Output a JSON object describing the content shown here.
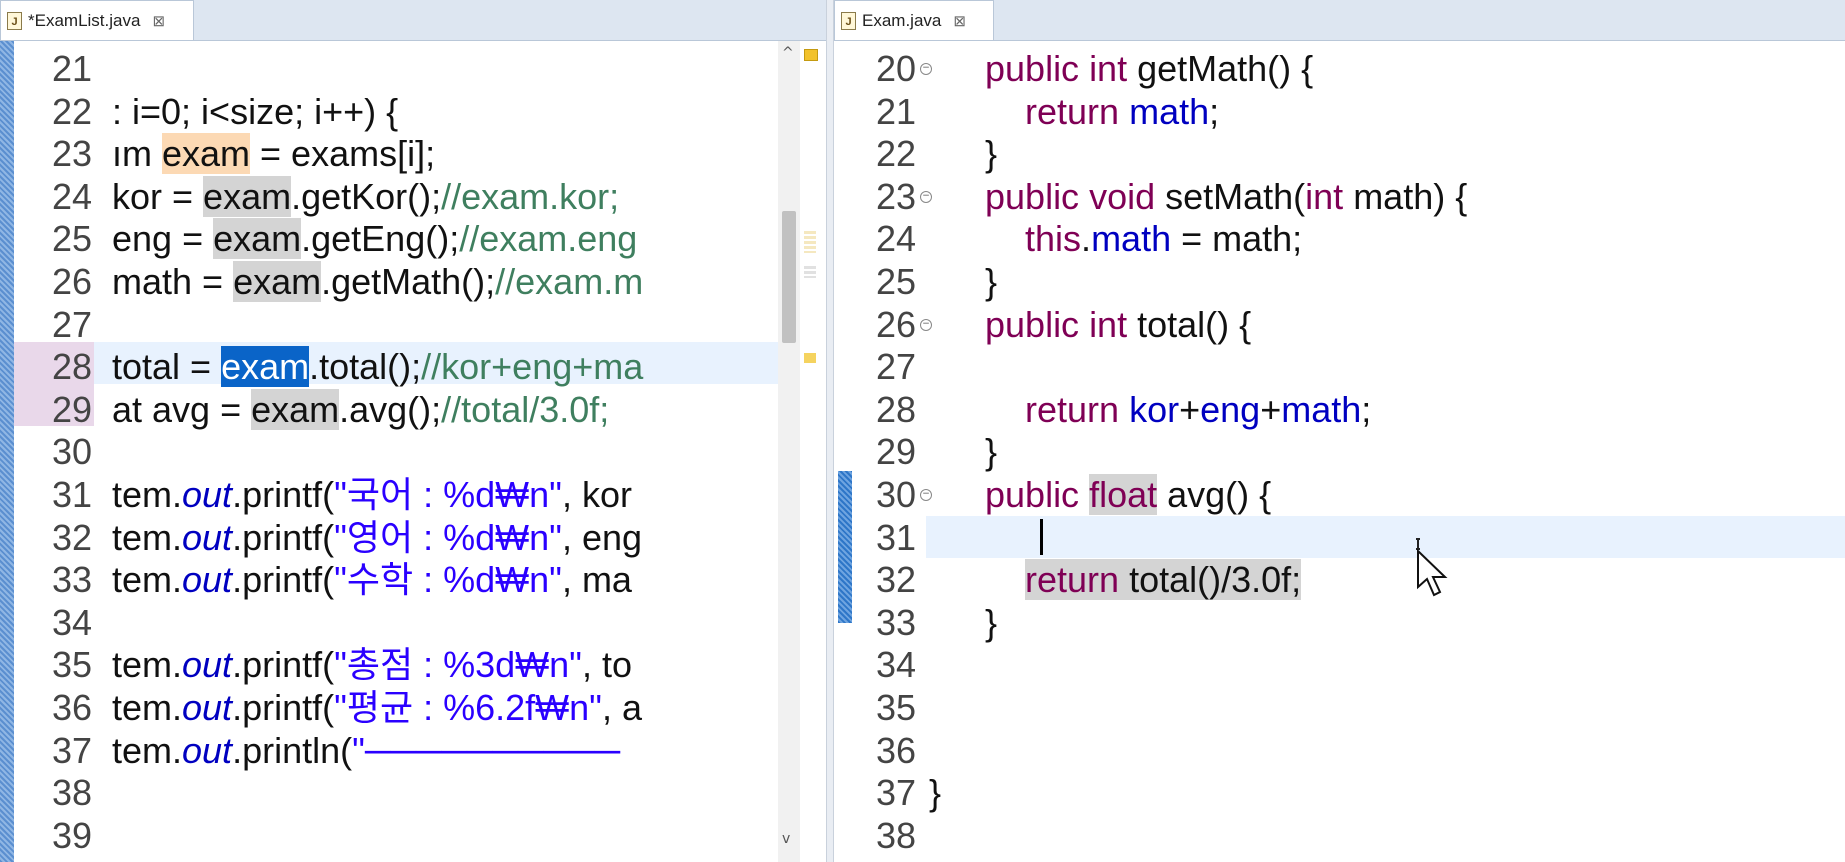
{
  "left_editor": {
    "tab": {
      "label": "*ExamList.java",
      "icon": "java-file-icon",
      "close_icon": "close-icon"
    },
    "lines": [
      {
        "n": "21",
        "html": ""
      },
      {
        "n": "22",
        "html": ": i=0; i&lt;size; i++) {"
      },
      {
        "n": "23",
        "html": "ım <span class=\"hl-or\">exam</span> = exams[i];"
      },
      {
        "n": "24",
        "html": "kor = <span class=\"occ\">exam</span>.getKor();<span class=\"cm\">//exam.kor;</span>"
      },
      {
        "n": "25",
        "html": "eng = <span class=\"occ\">exam</span>.getEng();<span class=\"cm\">//exam.eng</span>"
      },
      {
        "n": "26",
        "html": "math = <span class=\"occ\">exam</span>.getMath();<span class=\"cm\">//exam.m</span>"
      },
      {
        "n": "27",
        "html": ""
      },
      {
        "n": "28",
        "html": "total = <span class=\"sel\">exam</span>.total();<span class=\"cm\">//kor+eng+ma</span>"
      },
      {
        "n": "29",
        "html": "at avg = <span class=\"occ\">exam</span>.avg();<span class=\"cm\">//total/3.0f;</span>"
      },
      {
        "n": "30",
        "html": ""
      },
      {
        "n": "31",
        "html": "tem.<span class=\"it\">out</span>.printf(<span class=\"str\">\"국어 : %d₩n\"</span>, kor"
      },
      {
        "n": "32",
        "html": "tem.<span class=\"it\">out</span>.printf(<span class=\"str\">\"영어 : %d₩n\"</span>, eng"
      },
      {
        "n": "33",
        "html": "tem.<span class=\"it\">out</span>.printf(<span class=\"str\">\"수학 : %d₩n\"</span>, ma"
      },
      {
        "n": "34",
        "html": ""
      },
      {
        "n": "35",
        "html": "tem.<span class=\"it\">out</span>.printf(<span class=\"str\">\"총점 : %3d₩n\"</span>, to"
      },
      {
        "n": "36",
        "html": "tem.<span class=\"it\">out</span>.printf(<span class=\"str\">\"평균 : %6.2f₩n\"</span>, a"
      },
      {
        "n": "37",
        "html": "tem.<span class=\"it\">out</span>.println(<span class=\"str\">\"──────────</span>"
      },
      {
        "n": "38",
        "html": ""
      },
      {
        "n": "39",
        "html": ""
      }
    ]
  },
  "right_editor": {
    "tab": {
      "label": "Exam.java",
      "icon": "java-file-icon",
      "close_icon": "close-icon"
    },
    "lines": [
      {
        "n": "20",
        "fold": true,
        "html": "<span class=\"kw\">public int</span> getMath() {"
      },
      {
        "n": "21",
        "html": "    <span class=\"kw\">return</span> <span class=\"fld\">math</span>;"
      },
      {
        "n": "22",
        "html": "}"
      },
      {
        "n": "23",
        "fold": true,
        "html": "<span class=\"kw\">public void</span> setMath(<span class=\"kw\">int</span> math) {"
      },
      {
        "n": "24",
        "html": "    <span class=\"kw\">this</span>.<span class=\"fld\">math</span> = math;"
      },
      {
        "n": "25",
        "html": "}"
      },
      {
        "n": "26",
        "fold": true,
        "html": "<span class=\"kw\">public int</span> total() {"
      },
      {
        "n": "27",
        "html": ""
      },
      {
        "n": "28",
        "html": "    <span class=\"kw\">return</span> <span class=\"fld\">kor</span>+<span class=\"fld\">eng</span>+<span class=\"fld\">math</span>;"
      },
      {
        "n": "29",
        "html": "}"
      },
      {
        "n": "30",
        "fold": true,
        "html": "<span class=\"kw\">public</span> <span class=\"occ kw\">float</span> avg() {"
      },
      {
        "n": "31",
        "html": ""
      },
      {
        "n": "32",
        "html": "    <span class=\"occ\"><span class=\"kw\">return</span> total()/3.0f;</span>"
      },
      {
        "n": "33",
        "html": "}"
      },
      {
        "n": "34",
        "html": ""
      },
      {
        "n": "35",
        "html": ""
      },
      {
        "n": "36",
        "html": ""
      },
      {
        "n": "37",
        "html": "}"
      },
      {
        "n": "38",
        "html": ""
      }
    ]
  },
  "colors": {
    "keyword": "#7f0055",
    "field": "#0000c0",
    "string": "#2a00ff",
    "comment": "#3f7f5f",
    "selection": "#0a64c8",
    "current_line": "#e8f2fe"
  }
}
